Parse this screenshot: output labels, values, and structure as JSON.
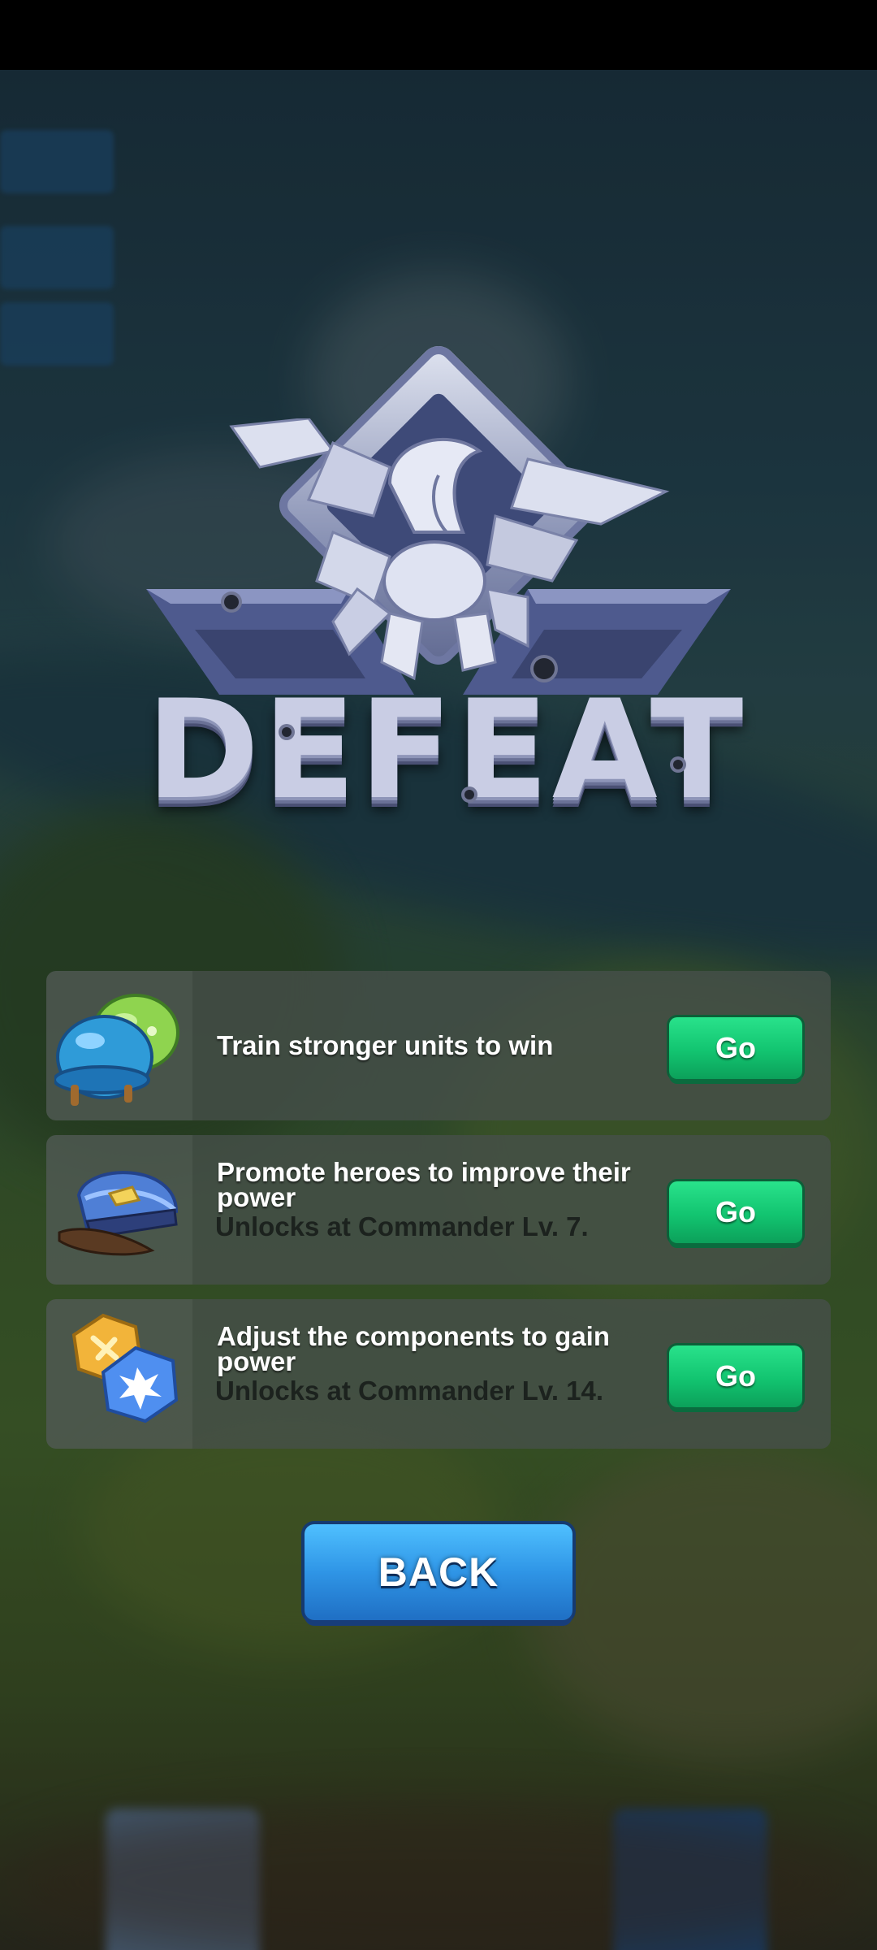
{
  "screen": {
    "title": "DEFEAT"
  },
  "tips": [
    {
      "icon": "helmets-icon",
      "title": "Train stronger units to win",
      "subtitle": "",
      "button": "Go"
    },
    {
      "icon": "officer-cap-icon",
      "title": "Promote heroes to improve their power",
      "subtitle": "Unlocks at Commander Lv. 7.",
      "button": "Go"
    },
    {
      "icon": "components-icon",
      "title": "Adjust the components to gain power",
      "subtitle": "Unlocks at Commander Lv. 14.",
      "button": "Go"
    }
  ],
  "back_button": "BACK",
  "colors": {
    "go_button": "#12c470",
    "back_button": "#2f95e6",
    "card_bg": "#46504a"
  }
}
